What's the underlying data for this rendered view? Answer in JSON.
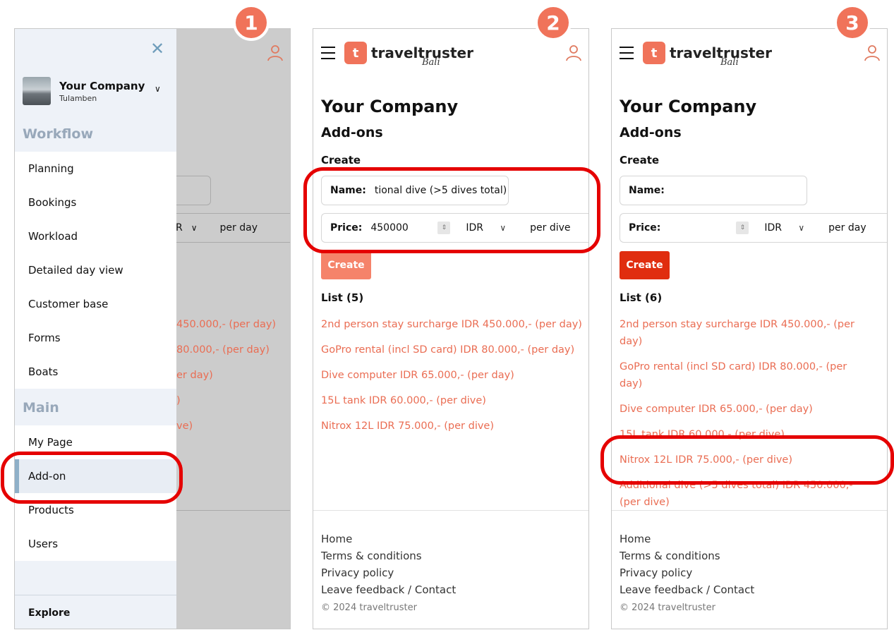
{
  "badges": [
    "1",
    "2",
    "3"
  ],
  "brand": {
    "mark": "t",
    "name": "traveltruster",
    "region": "Bali"
  },
  "drawer": {
    "company_name": "Your Company",
    "company_location": "Tulamben",
    "workflow_heading": "Workflow",
    "workflow_items": [
      "Planning",
      "Bookings",
      "Workload",
      "Detailed day view",
      "Customer base",
      "Forms",
      "Boats"
    ],
    "main_heading": "Main",
    "main_items": [
      "My Page",
      "Add-on",
      "Products",
      "Users"
    ],
    "footer": "Explore"
  },
  "panel1_bg": {
    "currency_partial": "R",
    "unit": "per day",
    "list": [
      "450.000,- (per day)",
      "80.000,- (per day)",
      "er day)",
      ")",
      "ve)"
    ]
  },
  "page": {
    "title": "Your Company",
    "subtitle": "Add-ons",
    "create_label": "Create",
    "name_label": "Name:",
    "price_label": "Price:",
    "create_button": "Create",
    "stepper": "⇕"
  },
  "panel2": {
    "name_value": "tional dive (>5 dives total)",
    "price_value": "450000",
    "currency": "IDR",
    "unit": "per dive",
    "list_label": "List (5)",
    "list": [
      "2nd person stay surcharge IDR 450.000,- (per day)",
      "GoPro rental (incl SD card) IDR 80.000,- (per day)",
      "Dive computer IDR 65.000,- (per day)",
      "15L tank IDR 60.000,- (per dive)",
      "Nitrox 12L IDR 75.000,- (per dive)"
    ]
  },
  "panel3": {
    "name_value": "",
    "price_value": "",
    "currency": "IDR",
    "unit": "per day",
    "list_label": "List (6)",
    "list": [
      "2nd person stay surcharge IDR 450.000,- (per day)",
      "GoPro rental (incl SD card) IDR 80.000,- (per day)",
      "Dive computer IDR 65.000,- (per day)",
      "15L tank IDR 60.000,- (per dive)",
      "Nitrox 12L IDR 75.000,- (per dive)",
      "Additional dive (>5 dives total) IDR 450.000,- (per dive)"
    ]
  },
  "footer": {
    "links": [
      "Home",
      "Terms & conditions",
      "Privacy policy",
      "Leave feedback / Contact"
    ],
    "copyright": "© 2024 traveltruster"
  },
  "colors": {
    "accent": "#f0735a",
    "button_active": "#e02d0f",
    "button_disabled": "#f5836a",
    "highlight": "#e50000"
  }
}
